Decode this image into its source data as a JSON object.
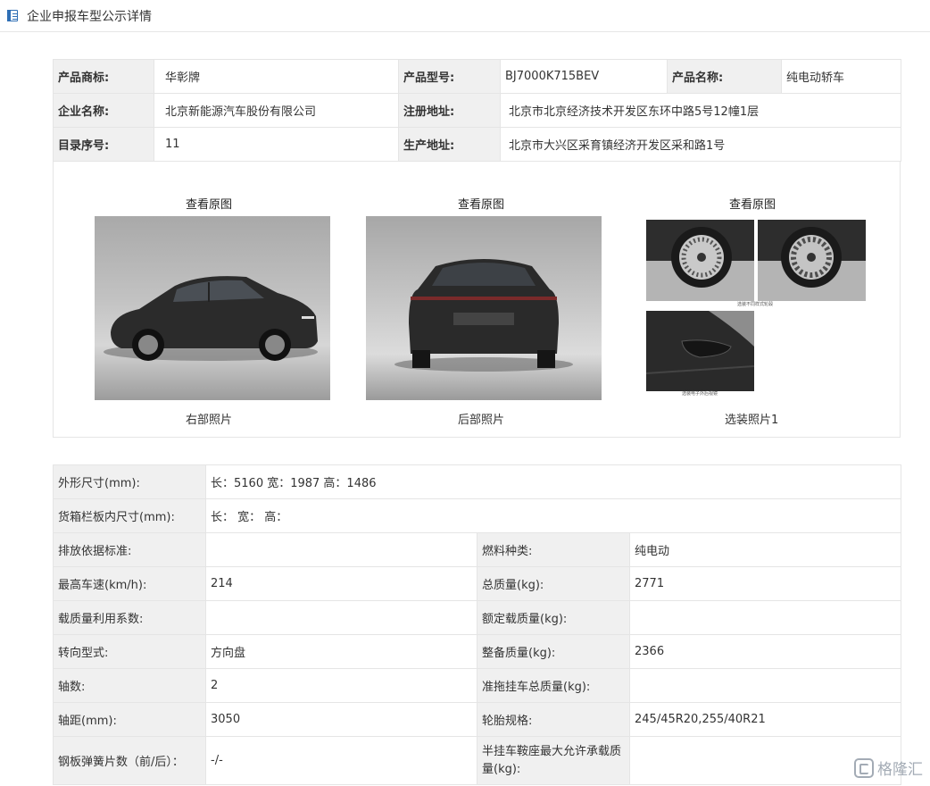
{
  "header": {
    "title": "企业申报车型公示详情",
    "icon": "document-icon"
  },
  "info": {
    "brand_label": "产品商标:",
    "brand_value": "华彰牌",
    "model_label": "产品型号:",
    "model_value": "BJ7000K715BEV",
    "name_label": "产品名称:",
    "name_value": "纯电动轿车",
    "company_label": "企业名称:",
    "company_value": "北京新能源汽车股份有限公司",
    "reg_addr_label": "注册地址:",
    "reg_addr_value": "北京市北京经济技术开发区东环中路5号12幢1层",
    "catalog_label": "目录序号:",
    "catalog_value": "11",
    "prod_addr_label": "生产地址:",
    "prod_addr_value": "北京市大兴区采育镇经济开发区采和路1号"
  },
  "photos": [
    {
      "link": "查看原图",
      "caption": "右部照片"
    },
    {
      "link": "查看原图",
      "caption": "后部照片"
    },
    {
      "link": "查看原图",
      "caption": "选装照片1",
      "thumb_captions": [
        "选装不同样式轮毂",
        "选装电子外后视镜"
      ]
    }
  ],
  "specs": {
    "dims_label": "外形尺寸(mm):",
    "dims_value": "长：5160 宽：1987 高：1486",
    "cargo_label": "货箱栏板内尺寸(mm):",
    "cargo_value": "长：  宽：  高：",
    "emission_label": "排放依据标准:",
    "emission_value": "",
    "fuel_label": "燃料种类:",
    "fuel_value": "纯电动",
    "speed_label": "最高车速(km/h):",
    "speed_value": "214",
    "total_mass_label": "总质量(kg):",
    "total_mass_value": "2771",
    "load_coef_label": "载质量利用系数:",
    "load_coef_value": "",
    "rated_load_label": "额定载质量(kg):",
    "rated_load_value": "",
    "steering_label": "转向型式:",
    "steering_value": "方向盘",
    "curb_mass_label": "整备质量(kg):",
    "curb_mass_value": "2366",
    "axles_label": "轴数:",
    "axles_value": "2",
    "trailer_label": "准拖挂车总质量(kg):",
    "trailer_value": "",
    "wheelbase_label": "轴距(mm):",
    "wheelbase_value": "3050",
    "tire_label": "轮胎规格:",
    "tire_value": "245/45R20,255/40R21",
    "spring_label": "钢板弹簧片数（前/后）：",
    "spring_value": "-/-",
    "saddle_label": "半挂车鞍座最大允许承载质量(kg):",
    "saddle_value": ""
  },
  "watermark": {
    "text": "格隆汇",
    "icon": "gelonghui-logo-icon"
  }
}
